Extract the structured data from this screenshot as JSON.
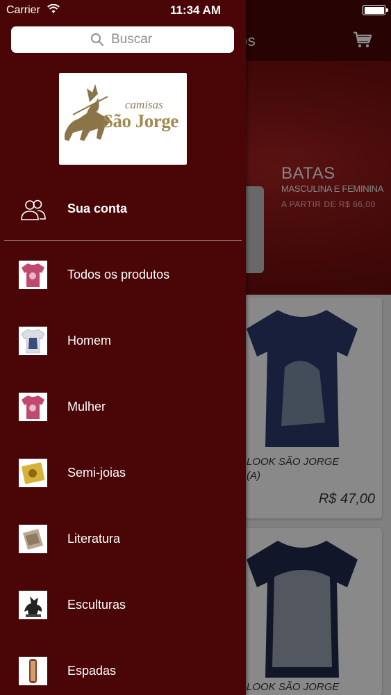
{
  "status_bar": {
    "carrier": "Carrier",
    "time": "11:34 AM"
  },
  "background": {
    "nav_title_fragment": "os",
    "banner": {
      "title": "BATAS",
      "subtitle": "MASCULINA E FEMININA",
      "price_line": "A PARTIR DE R$ 66,00"
    },
    "products": [
      {
        "name_line1": "LOOK SÃO JORGE",
        "name_line2": "(A)",
        "price": "R$ 47,00",
        "shirt_color": "#2c3a6b"
      },
      {
        "name_line1": "LOOK SÃO JORGE",
        "shirt_color": "#1f2a4c"
      }
    ]
  },
  "drawer": {
    "search": {
      "placeholder": "Buscar"
    },
    "logo": {
      "line1": "camisas",
      "line2": "São Jorge"
    },
    "account": {
      "label": "Sua conta",
      "icon": "users-icon"
    },
    "menu": [
      {
        "label": "Todos os produtos",
        "thumb": "pink-shirt",
        "color": "#c04a6f"
      },
      {
        "label": "Homem",
        "thumb": "white-shirt",
        "color": "#dcdce4"
      },
      {
        "label": "Mulher",
        "thumb": "pink-shirt",
        "color": "#c04a6f"
      },
      {
        "label": "Semi-joias",
        "thumb": "gold-pendant",
        "color": "#d8b13a"
      },
      {
        "label": "Literatura",
        "thumb": "book",
        "color": "#b8a890"
      },
      {
        "label": "Esculturas",
        "thumb": "sculpture",
        "color": "#222222"
      },
      {
        "label": "Espadas",
        "thumb": "sword",
        "color": "#8b3a2a"
      }
    ]
  },
  "colors": {
    "drawer_bg": "#4a0606",
    "nav_bg": "#4a0606",
    "accent_text": "#ffffff"
  }
}
